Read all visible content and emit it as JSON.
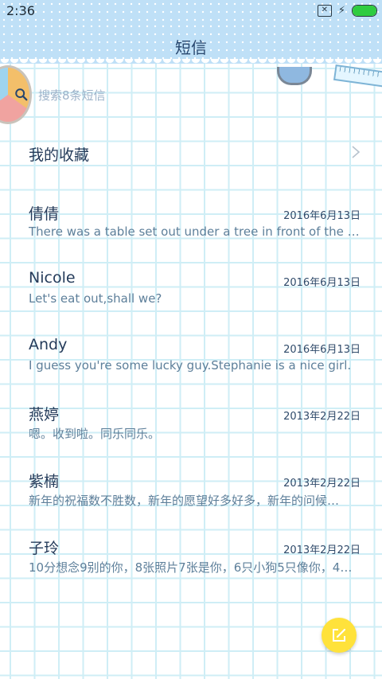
{
  "status_bar": {
    "time": "2:36",
    "icons": [
      "close-box-icon",
      "bolt-icon",
      "battery-icon"
    ],
    "battery_level": 1.0,
    "battery_color": "#2ecc40"
  },
  "header": {
    "title": "短信",
    "background_color": "#bfe0f7"
  },
  "search": {
    "placeholder": "搜索8条短信",
    "icon": "search-icon"
  },
  "favorites": {
    "label": "我的收藏",
    "icon": "chevron-right-icon"
  },
  "messages": [
    {
      "name": "倩倩",
      "date": "2016年6月13日",
      "preview": "There was a table set out under a tree in front of the ho…"
    },
    {
      "name": "Nicole",
      "date": "2016年6月13日",
      "preview": "Let's eat out,shall we?"
    },
    {
      "name": "Andy",
      "date": "2016年6月13日",
      "preview": "I guess you're some lucky guy.Stephanie is a nice girl."
    },
    {
      "name": "燕婷",
      "date": "2013年2月22日",
      "preview": "嗯。收到啦。同乐同乐。"
    },
    {
      "name": "紫楠",
      "date": "2013年2月22日",
      "preview": "新年的祝福数不胜数，新年的愿望好多好多，新年的问候…"
    },
    {
      "name": "子玲",
      "date": "2013年2月22日",
      "preview": "10分想念9别的你，8张照片7张是你，6只小狗5只像你，4…"
    }
  ],
  "compose_button": {
    "icon": "compose-icon",
    "color": "#ffe23b"
  }
}
